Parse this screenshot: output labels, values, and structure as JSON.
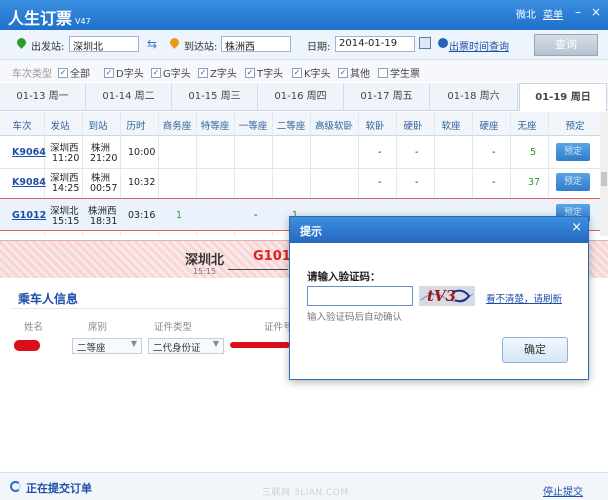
{
  "titlebar": {
    "title": "人生订票",
    "version": "V47",
    "link1": "微北",
    "link2": "菜单",
    "colors": {
      "bar": "#2a7ad4"
    }
  },
  "search": {
    "from_label": "出发站:",
    "from_value": "深圳北",
    "to_label": "到达站:",
    "to_value": "株洲西",
    "date_label": "日期:",
    "date_value": "2014-01-19",
    "time_link": "出票时间查询",
    "query_label": "查询"
  },
  "filters": {
    "label": "车次类型",
    "options": [
      {
        "label": "全部",
        "checked": true
      },
      {
        "label": "D字头",
        "checked": true
      },
      {
        "label": "G字头",
        "checked": true
      },
      {
        "label": "Z字头",
        "checked": true
      },
      {
        "label": "T字头",
        "checked": true
      },
      {
        "label": "K字头",
        "checked": true
      },
      {
        "label": "其他",
        "checked": true
      },
      {
        "label": "学生票",
        "checked": false
      }
    ]
  },
  "date_tabs": [
    {
      "label": "01-13 周一"
    },
    {
      "label": "01-14 周二"
    },
    {
      "label": "01-15 周三"
    },
    {
      "label": "01-16 周四"
    },
    {
      "label": "01-17 周五"
    },
    {
      "label": "01-18 周六"
    },
    {
      "label": "01-19 周日",
      "active": true
    }
  ],
  "grid": {
    "headers": [
      "车次",
      "发站",
      "到站",
      "历时",
      "商务座",
      "特等座",
      "一等座",
      "二等座",
      "高级软卧",
      "软卧",
      "硬卧",
      "软座",
      "硬座",
      "无座",
      "预定"
    ],
    "rows": [
      {
        "train": "K9064",
        "from": "深圳西",
        "dep": "11:20",
        "to": "株洲",
        "arr": "21:20",
        "duration": "10:00",
        "ruanwo": "-",
        "yingwo": "-",
        "yingzuo": "-",
        "wuzuo": "5",
        "book": "预定"
      },
      {
        "train": "K9084",
        "from": "深圳西",
        "dep": "14:25",
        "to": "株洲",
        "arr": "00:57",
        "duration": "10:32",
        "ruanwo": "-",
        "yingwo": "-",
        "yingzuo": "-",
        "wuzuo": "37",
        "book": "预定"
      },
      {
        "train": "G1012",
        "from": "深圳北",
        "dep": "15:15",
        "to": "株洲西",
        "arr": "18:31",
        "duration": "03:16",
        "shangwu": "1",
        "yideng": "-",
        "erdeng": "1",
        "book": "预定"
      }
    ]
  },
  "banner": {
    "from": "深圳北",
    "time": "15:15",
    "train": "G1012"
  },
  "passenger": {
    "title": "乘车人信息",
    "headers": [
      "姓名",
      "席别",
      "证件类型",
      "证件号"
    ],
    "seat": "二等座",
    "id_type": "二代身份证"
  },
  "dialog": {
    "title": "提示",
    "close": "×",
    "label": "请输入验证码：",
    "input_value": "",
    "captcha_text": "tV3",
    "refresh": "看不清楚，请刷新",
    "hint": "输入验证码后自动确认",
    "ok": "确定"
  },
  "footer": {
    "status": "正在提交订单",
    "stop": "停止提交",
    "watermark": "三联网 3LIAN.COM"
  }
}
